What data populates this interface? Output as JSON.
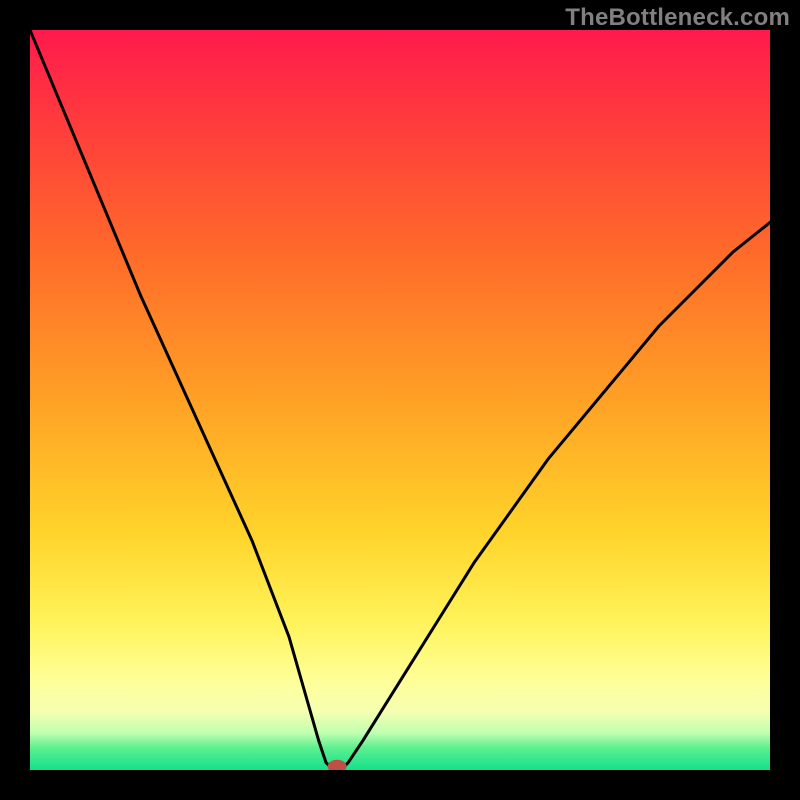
{
  "watermark": "TheBottleneck.com",
  "chart_data": {
    "type": "line",
    "title": "",
    "xlabel": "",
    "ylabel": "",
    "xlim": [
      0,
      100
    ],
    "ylim": [
      0,
      100
    ],
    "grid": false,
    "legend": false,
    "series": [
      {
        "name": "curve",
        "x": [
          0,
          5,
          10,
          15,
          20,
          25,
          30,
          35,
          37,
          39,
          40,
          41,
          42,
          43,
          45,
          50,
          55,
          60,
          65,
          70,
          75,
          80,
          85,
          90,
          95,
          100
        ],
        "y": [
          100,
          88,
          76,
          64,
          53,
          42,
          31,
          18,
          11,
          4,
          1,
          0,
          0,
          1,
          4,
          12,
          20,
          28,
          35,
          42,
          48,
          54,
          60,
          65,
          70,
          74
        ]
      }
    ],
    "marker": {
      "x": 41.5,
      "y": 0.5
    },
    "background_gradient": {
      "stops": [
        {
          "pos": 0,
          "color": "#ff1a4d"
        },
        {
          "pos": 50,
          "color": "#ffa125"
        },
        {
          "pos": 88,
          "color": "#ffff99"
        },
        {
          "pos": 100,
          "color": "#13e08c"
        }
      ]
    }
  }
}
